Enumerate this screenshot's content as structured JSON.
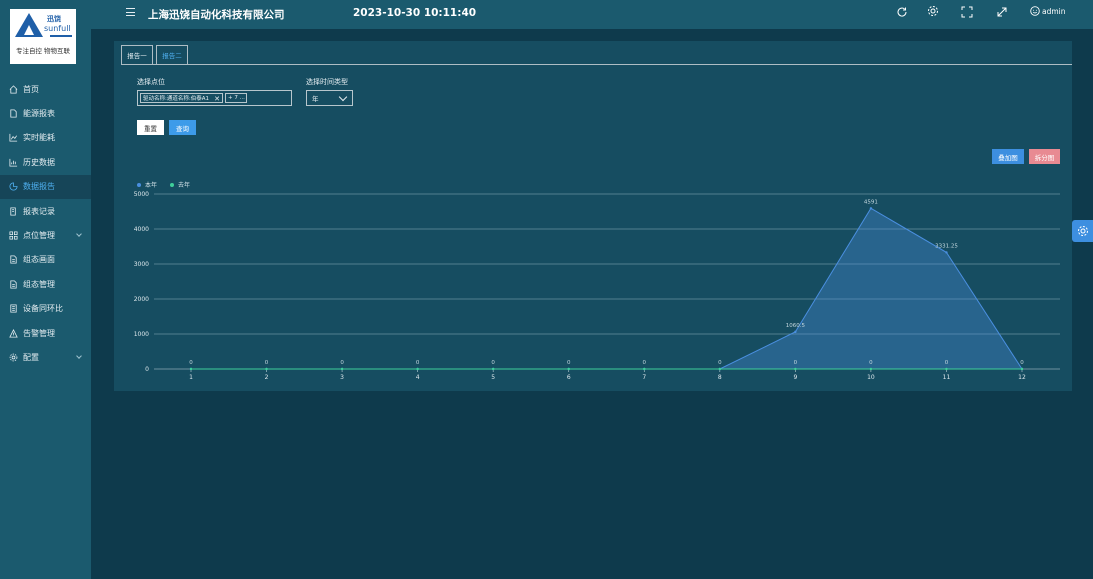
{
  "logo": {
    "brand_cn": "迅饶",
    "brand_en": "sunfull",
    "slogan": "专注自控 物物互联"
  },
  "sidebar": {
    "items": [
      {
        "label": "首页",
        "icon": "home-icon"
      },
      {
        "label": "能源报表",
        "icon": "report-icon"
      },
      {
        "label": "实时能耗",
        "icon": "realtime-chart-icon"
      },
      {
        "label": "历史数据",
        "icon": "history-chart-icon"
      },
      {
        "label": "数据报告",
        "icon": "pie-chart-icon",
        "active": true
      },
      {
        "label": "报表记录",
        "icon": "record-icon"
      },
      {
        "label": "点位管理",
        "icon": "grid-icon",
        "expandable": true
      },
      {
        "label": "组态画面",
        "icon": "document-icon"
      },
      {
        "label": "组态管理",
        "icon": "document-icon"
      },
      {
        "label": "设备同环比",
        "icon": "list-icon"
      },
      {
        "label": "告警管理",
        "icon": "warning-icon"
      },
      {
        "label": "配置",
        "icon": "gear-icon",
        "expandable": true
      }
    ]
  },
  "header": {
    "company": "上海迅饶自动化科技有限公司",
    "datetime": "2023-10-30 10:11:40",
    "user": "admin"
  },
  "tabs": [
    {
      "label": "报告一"
    },
    {
      "label": "报告二",
      "active": true
    }
  ],
  "filters": {
    "point_label": "选择点位",
    "point_tag": "驱动名称:通道名称:伯泰A1",
    "point_more": "+ 7 ...",
    "time_label": "选择时间类型",
    "time_value": "年"
  },
  "buttons": {
    "reset": "重置",
    "query": "查询",
    "stack": "叠加图",
    "split": "拆分图"
  },
  "chart_data": {
    "type": "area",
    "x": [
      "1",
      "2",
      "3",
      "4",
      "5",
      "6",
      "7",
      "8",
      "9",
      "10",
      "11",
      "12"
    ],
    "series": [
      {
        "name": "本年",
        "values": [
          0,
          0,
          0,
          0,
          0,
          0,
          0,
          0,
          1060.5,
          4591,
          3331.25,
          0
        ],
        "labels": [
          "",
          "",
          "",
          "",
          "",
          "",
          "",
          "",
          "1060.5",
          "4591",
          "3331.25",
          ""
        ],
        "color": "#4a8fe0"
      },
      {
        "name": "去年",
        "values": [
          0,
          0,
          0,
          0,
          0,
          0,
          0,
          0,
          0,
          0,
          0,
          0
        ],
        "labels": [
          "0",
          "0",
          "0",
          "0",
          "0",
          "0",
          "0",
          "0",
          "0",
          "0",
          "0",
          "0"
        ],
        "color": "#3fcf9a"
      }
    ],
    "ylim": [
      0,
      5000
    ],
    "yticks": [
      "0",
      "1000",
      "2000",
      "3000",
      "4000",
      "5000"
    ],
    "grid": true,
    "legend": "top-left"
  }
}
